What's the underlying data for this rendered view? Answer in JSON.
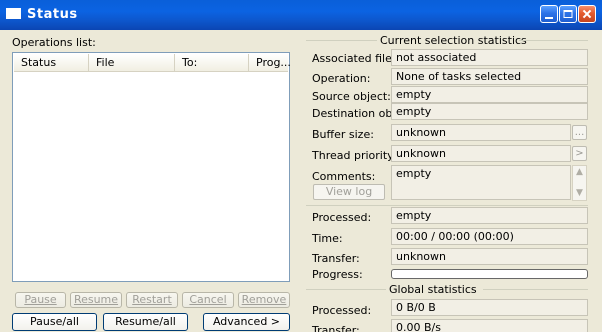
{
  "window": {
    "title": "Status"
  },
  "operations": {
    "label": "Operations list:",
    "columns": [
      "Status",
      "File",
      "To:",
      "Prog..."
    ]
  },
  "current_stats": {
    "title": "Current selection statistics",
    "associated_file_label": "Associated file:",
    "associated_file_value": "not associated",
    "operation_label": "Operation:",
    "operation_value": "None of tasks selected",
    "source_label": "Source object:",
    "source_value": "empty",
    "destination_label": "Destination object:",
    "destination_value": "empty",
    "buffer_label": "Buffer size:",
    "buffer_value": "unknown",
    "buffer_button": "...",
    "priority_label": "Thread priority:",
    "priority_value": "unknown",
    "priority_button": ">",
    "comments_label": "Comments:",
    "comments_value": "empty",
    "view_log_button": "View log",
    "processed_label": "Processed:",
    "processed_value": "empty",
    "time_label": "Time:",
    "time_value": "00:00 / 00:00 (00:00)",
    "transfer_label": "Transfer:",
    "transfer_value": "unknown",
    "progress_label": "Progress:",
    "progress_fraction": 0
  },
  "global_stats": {
    "title": "Global statistics",
    "processed_label": "Processed:",
    "processed_value": "0 B/0 B",
    "transfer_label": "Transfer:",
    "transfer_value": "0.00 B/s"
  },
  "buttons": {
    "pause": "Pause",
    "resume": "Resume",
    "restart": "Restart",
    "cancel": "Cancel",
    "remove": "Remove",
    "pause_all": "Pause/all",
    "resume_all": "Resume/all",
    "advanced": "Advanced >"
  },
  "colors": {
    "titlebar": "#0b63e2",
    "window_bg": "#ece9d8",
    "progress_fill": "#2fa93d"
  }
}
